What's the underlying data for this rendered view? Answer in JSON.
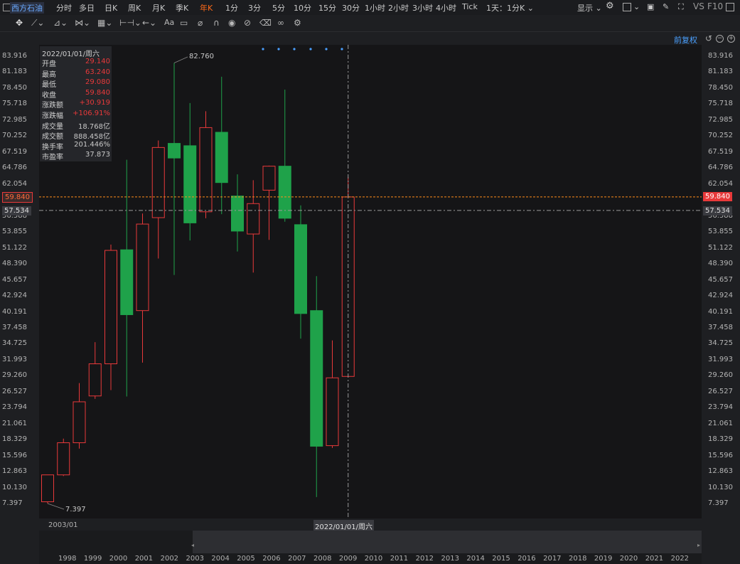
{
  "topbar": {
    "tabs": [
      {
        "label": "西方石油",
        "x": 14,
        "active": false,
        "accent": true
      },
      {
        "label": "分时",
        "x": 79
      },
      {
        "label": "多日",
        "x": 111
      },
      {
        "label": "日K",
        "x": 147
      },
      {
        "label": "周K",
        "x": 180
      },
      {
        "label": "月K",
        "x": 214
      },
      {
        "label": "季K",
        "x": 247
      },
      {
        "label": "年K",
        "x": 281,
        "active": true
      },
      {
        "label": "1分",
        "x": 317
      },
      {
        "label": "3分",
        "x": 349
      },
      {
        "label": "5分",
        "x": 383
      },
      {
        "label": "10分",
        "x": 413
      },
      {
        "label": "15分",
        "x": 448
      },
      {
        "label": "30分",
        "x": 481
      },
      {
        "label": "1小时",
        "x": 513
      },
      {
        "label": "2小时",
        "x": 546
      },
      {
        "label": "3小时",
        "x": 580
      },
      {
        "label": "4小时",
        "x": 613
      },
      {
        "label": "Tick",
        "x": 650
      }
    ],
    "period_select": "1天：1分K",
    "display_label": "显示",
    "vs_label": "VS",
    "f10_label": "F10"
  },
  "toolbar": {
    "adjust_label": "前复权"
  },
  "info": {
    "date": "2022/01/01/周六",
    "rows": [
      {
        "k": "开盘",
        "v": "29.140",
        "c": "#e8393a"
      },
      {
        "k": "最高",
        "v": "63.240",
        "c": "#e8393a"
      },
      {
        "k": "最低",
        "v": "29.080",
        "c": "#e8393a"
      },
      {
        "k": "收盘",
        "v": "59.840",
        "c": "#e8393a"
      },
      {
        "k": "涨跌额",
        "v": "+30.919",
        "c": "#e8393a"
      },
      {
        "k": "涨跌幅",
        "v": "+106.91%",
        "c": "#e8393a"
      },
      {
        "k": "成交量",
        "v": "18.768亿",
        "c": "#c8c8c8"
      },
      {
        "k": "成交额",
        "v": "888.458亿",
        "c": "#c8c8c8"
      },
      {
        "k": "换手率",
        "v": "201.446%",
        "c": "#c8c8c8"
      },
      {
        "k": "市盈率",
        "v": "37.873",
        "c": "#c8c8c8"
      }
    ]
  },
  "colors": {
    "up": "#e8393a",
    "down": "#1fa24a",
    "accent": "#4aa0ff",
    "price_line": "#ff8c1a"
  },
  "price_axis": {
    "ticks": [
      "83.916",
      "81.183",
      "78.450",
      "75.718",
      "72.985",
      "70.252",
      "67.519",
      "64.786",
      "62.054",
      "59.321",
      "56.588",
      "53.855",
      "51.122",
      "48.390",
      "45.657",
      "42.924",
      "40.191",
      "37.458",
      "34.725",
      "31.993",
      "29.260",
      "26.527",
      "23.794",
      "21.061",
      "18.329",
      "15.596",
      "12.863",
      "10.130",
      "7.397"
    ],
    "current_price": "59.840",
    "crosshair_price": "57.534",
    "high_label": "82.760",
    "low_label": "7.397"
  },
  "time_axis": {
    "start_label": "2003/01",
    "cursor_label": "2022/01/01/周六"
  },
  "navigator_years": [
    "1998",
    "1999",
    "2000",
    "2001",
    "2002",
    "2003",
    "2004",
    "2005",
    "2006",
    "2007",
    "2008",
    "2009",
    "2010",
    "2011",
    "2012",
    "2013",
    "2014",
    "2015",
    "2016",
    "2017",
    "2018",
    "2019",
    "2020",
    "2021",
    "2022"
  ],
  "chart_data": {
    "type": "candlestick",
    "period": "yearly",
    "x": [
      "2003",
      "2004",
      "2005",
      "2006",
      "2007",
      "2008",
      "2009",
      "2010",
      "2011",
      "2012",
      "2013",
      "2014",
      "2015",
      "2016",
      "2017",
      "2018",
      "2019",
      "2020",
      "2021",
      "2022"
    ],
    "candles": [
      {
        "o": 7.7,
        "h": 12.3,
        "l": 7.4,
        "c": 12.3
      },
      {
        "o": 12.3,
        "h": 18.5,
        "l": 12.1,
        "c": 17.8
      },
      {
        "o": 17.8,
        "h": 28.0,
        "l": 16.8,
        "c": 24.8
      },
      {
        "o": 25.8,
        "h": 35.0,
        "l": 25.3,
        "c": 31.3
      },
      {
        "o": 31.3,
        "h": 51.7,
        "l": 26.8,
        "c": 50.7
      },
      {
        "o": 50.8,
        "h": 66.2,
        "l": 25.7,
        "c": 39.7
      },
      {
        "o": 40.4,
        "h": 57.0,
        "l": 31.5,
        "c": 55.2
      },
      {
        "o": 56.3,
        "h": 69.5,
        "l": 49.3,
        "c": 68.3
      },
      {
        "o": 69.0,
        "h": 82.76,
        "l": 46.5,
        "c": 66.5
      },
      {
        "o": 68.6,
        "h": 75.9,
        "l": 52.4,
        "c": 55.4
      },
      {
        "o": 57.3,
        "h": 74.5,
        "l": 56.2,
        "c": 71.7
      },
      {
        "o": 70.9,
        "h": 80.4,
        "l": 56.9,
        "c": 62.3
      },
      {
        "o": 60.0,
        "h": 63.7,
        "l": 50.5,
        "c": 54.0
      },
      {
        "o": 53.5,
        "h": 62.7,
        "l": 46.9,
        "c": 58.7
      },
      {
        "o": 61.0,
        "h": 65.2,
        "l": 52.5,
        "c": 65.1
      },
      {
        "o": 65.1,
        "h": 78.2,
        "l": 55.6,
        "c": 56.2
      },
      {
        "o": 55.1,
        "h": 58.4,
        "l": 35.6,
        "c": 39.9
      },
      {
        "o": 40.4,
        "h": 46.3,
        "l": 8.5,
        "c": 17.2
      },
      {
        "o": 17.3,
        "h": 35.3,
        "l": 16.9,
        "c": 28.9
      },
      {
        "o": 29.14,
        "h": 63.24,
        "l": 29.08,
        "c": 59.84
      }
    ],
    "ylim": [
      7.397,
      83.916
    ]
  }
}
